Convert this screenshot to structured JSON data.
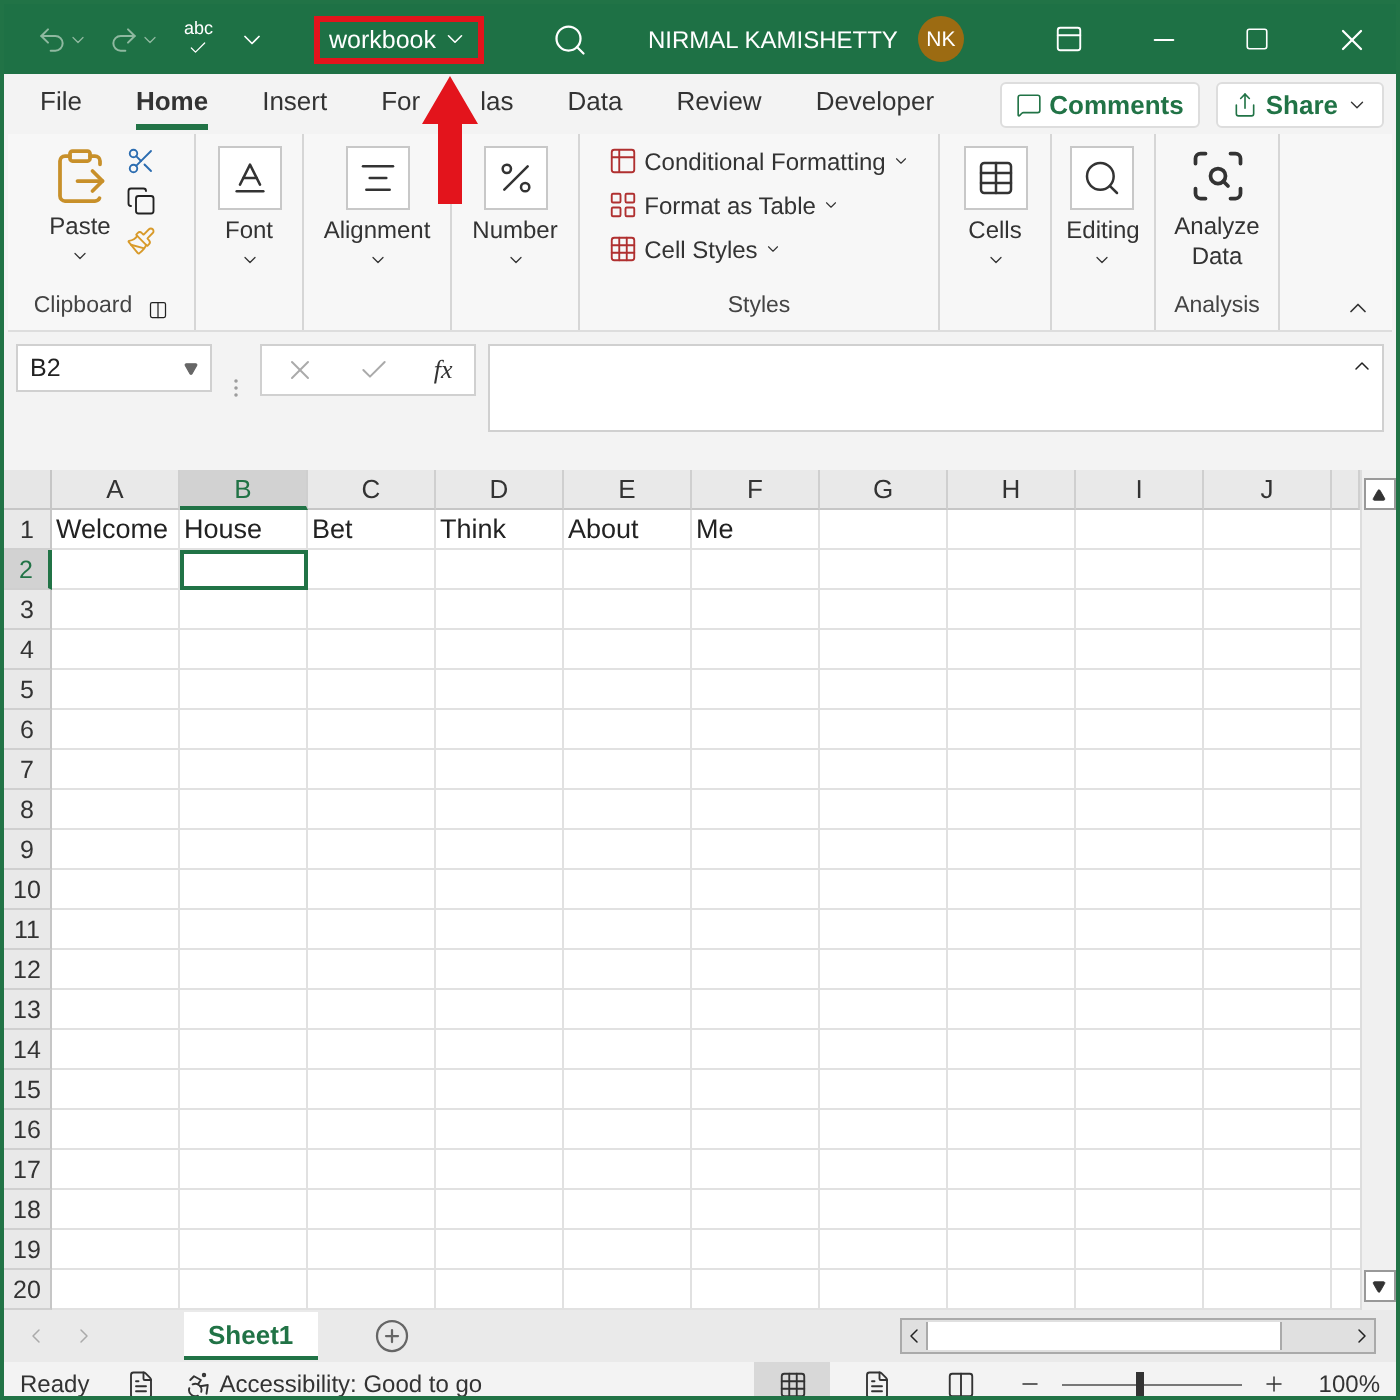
{
  "title_bar": {
    "spelling_label": "abc",
    "title": {
      "text": "workbook",
      "highlighted": true
    },
    "pointer_arrow": true,
    "user_name": "NIRMAL KAMISHETTY",
    "avatar_initials": "NK"
  },
  "tabs": [
    {
      "label": "File",
      "selected": false
    },
    {
      "label": "Home",
      "selected": true
    },
    {
      "label": "Insert",
      "selected": false
    },
    {
      "label_parts": [
        "For",
        "las"
      ],
      "selected": false
    },
    {
      "label": "Data",
      "selected": false
    },
    {
      "label": "Review",
      "selected": false
    },
    {
      "label": "Developer",
      "selected": false
    }
  ],
  "tab_buttons": [
    "Comments",
    "Share"
  ],
  "ribbon": {
    "groups": [
      {
        "kind": "clipboard",
        "label": "Clipboard",
        "items": [
          "Paste"
        ]
      },
      {
        "kind": "font",
        "items": [
          "Font"
        ]
      },
      {
        "kind": "alignment",
        "items": [
          "Alignment"
        ]
      },
      {
        "kind": "number",
        "items": [
          "Number"
        ]
      },
      {
        "kind": "styles",
        "label": "Styles",
        "items": [
          "Conditional Formatting",
          "Format as Table",
          "Cell Styles"
        ]
      },
      {
        "kind": "cells",
        "items": [
          "Cells"
        ]
      },
      {
        "kind": "editing",
        "items": [
          "Editing"
        ]
      },
      {
        "kind": "analysis",
        "label": "Analysis",
        "items": [
          "Analyze Data"
        ]
      }
    ]
  },
  "formula_bar": {
    "name_box": "B2",
    "function_label": "fx"
  },
  "sheet": {
    "columns": [
      {
        "label": "A",
        "selected": false
      },
      {
        "label": "B",
        "selected": true
      },
      {
        "label": "C",
        "selected": false
      },
      {
        "label": "D",
        "selected": false
      },
      {
        "label": "E",
        "selected": false
      },
      {
        "label": "F",
        "selected": false
      },
      {
        "label": "G",
        "selected": false
      },
      {
        "label": "H",
        "selected": false
      },
      {
        "label": "I",
        "selected": false
      },
      {
        "label": "J",
        "selected": false
      }
    ],
    "rows": [
      {
        "number": "1",
        "selected": false,
        "cells": [
          "Welcome",
          "House",
          "Bet",
          "Think",
          "About",
          "Me"
        ]
      },
      {
        "number": "2",
        "selected": true
      },
      {
        "number": "3",
        "selected": false
      },
      {
        "number": "4",
        "selected": false
      },
      {
        "number": "5",
        "selected": false
      },
      {
        "number": "6",
        "selected": false
      },
      {
        "number": "7",
        "selected": false
      },
      {
        "number": "8",
        "selected": false
      },
      {
        "number": "9",
        "selected": false
      },
      {
        "number": "10",
        "selected": false
      },
      {
        "number": "11",
        "selected": false
      },
      {
        "number": "12",
        "selected": false
      },
      {
        "number": "13",
        "selected": false
      },
      {
        "number": "14",
        "selected": false
      },
      {
        "number": "15",
        "selected": false
      },
      {
        "number": "16",
        "selected": false
      },
      {
        "number": "17",
        "selected": false
      },
      {
        "number": "18",
        "selected": false
      },
      {
        "number": "19",
        "selected": false
      },
      {
        "number": "20",
        "selected": false
      }
    ]
  },
  "sheet_tabs": [
    {
      "label": "Sheet1",
      "selected": true
    }
  ],
  "status_bar": {
    "status": "Ready",
    "accessibility": "Accessibility: Good to go",
    "views": [
      {
        "kind": "normal",
        "selected": true
      },
      {
        "kind": "page_layout",
        "selected": false
      },
      {
        "kind": "page_break",
        "selected": false
      }
    ],
    "zoom": {
      "level": 0.43,
      "reading": "100%"
    }
  }
}
